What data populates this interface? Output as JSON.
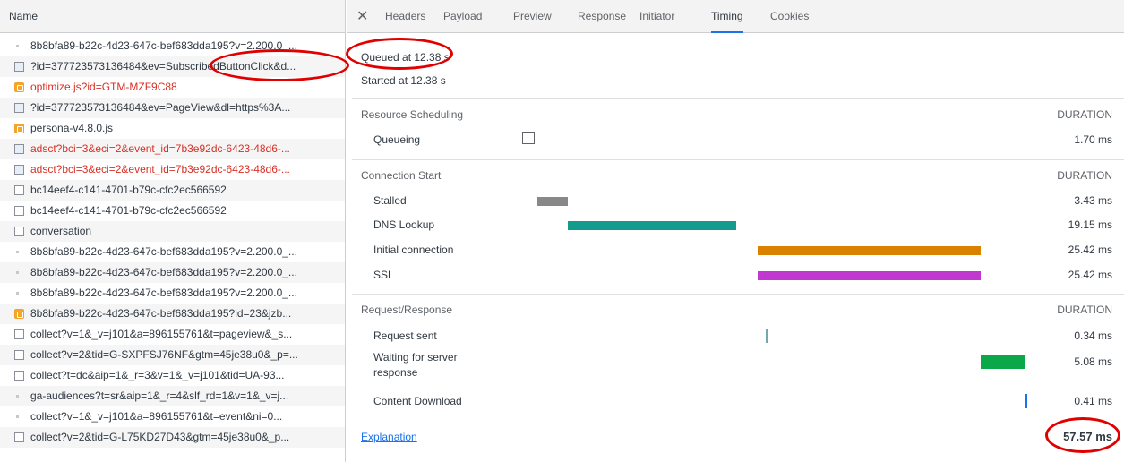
{
  "request_list": {
    "header": "Name",
    "items": [
      {
        "name": "8b8bfa89-b22c-4d23-647c-bef683dda195?v=2.200.0_...",
        "icon": "dot",
        "red": false
      },
      {
        "name": "?id=377723573136484&ev=SubscribedButtonClick&d...",
        "icon": "xhr",
        "red": false
      },
      {
        "name": "optimize.js?id=GTM-MZF9C88",
        "icon": "js",
        "red": true
      },
      {
        "name": "?id=377723573136484&ev=PageView&dl=https%3A...",
        "icon": "xhr",
        "red": false
      },
      {
        "name": "persona-v4.8.0.js",
        "icon": "js",
        "red": false
      },
      {
        "name": "adsct?bci=3&eci=2&event_id=7b3e92dc-6423-48d6-...",
        "icon": "xhr",
        "red": true
      },
      {
        "name": "adsct?bci=3&eci=2&event_id=7b3e92dc-6423-48d6-...",
        "icon": "xhr",
        "red": true
      },
      {
        "name": "bc14eef4-c141-4701-b79c-cfc2ec566592",
        "icon": "doc",
        "red": false
      },
      {
        "name": "bc14eef4-c141-4701-b79c-cfc2ec566592",
        "icon": "doc",
        "red": false
      },
      {
        "name": "conversation",
        "icon": "doc",
        "red": false
      },
      {
        "name": "8b8bfa89-b22c-4d23-647c-bef683dda195?v=2.200.0_...",
        "icon": "dot",
        "red": false
      },
      {
        "name": "8b8bfa89-b22c-4d23-647c-bef683dda195?v=2.200.0_...",
        "icon": "dot",
        "red": false
      },
      {
        "name": "8b8bfa89-b22c-4d23-647c-bef683dda195?v=2.200.0_...",
        "icon": "dot",
        "red": false
      },
      {
        "name": "8b8bfa89-b22c-4d23-647c-bef683dda195?id=23&jzb...",
        "icon": "js",
        "red": false
      },
      {
        "name": "collect?v=1&_v=j101&a=896155761&t=pageview&_s...",
        "icon": "doc",
        "red": false
      },
      {
        "name": "collect?v=2&tid=G-SXPFSJ76NF&gtm=45je38u0&_p=...",
        "icon": "doc",
        "red": false
      },
      {
        "name": "collect?t=dc&aip=1&_r=3&v=1&_v=j101&tid=UA-93...",
        "icon": "doc",
        "red": false
      },
      {
        "name": "ga-audiences?t=sr&aip=1&_r=4&slf_rd=1&v=1&_v=j...",
        "icon": "dot",
        "red": false
      },
      {
        "name": "collect?v=1&_v=j101&a=896155761&t=event&ni=0...",
        "icon": "dot",
        "red": false
      },
      {
        "name": "collect?v=2&tid=G-L75KD27D43&gtm=45je38u0&_p...",
        "icon": "doc",
        "red": false
      }
    ]
  },
  "tabs": {
    "close": "✕",
    "items": [
      "Headers",
      "Payload",
      "Preview",
      "Response",
      "Initiator",
      "Timing",
      "Cookies"
    ],
    "active": "Timing"
  },
  "timing": {
    "queued_at": "Queued at 12.38 s",
    "started_at": "Started at 12.38 s",
    "duration_header": "DURATION",
    "sections": [
      {
        "title": "Resource Scheduling",
        "rows": [
          {
            "label": "Queueing",
            "duration": "1.70 ms",
            "color": ""
          }
        ]
      },
      {
        "title": "Connection Start",
        "rows": [
          {
            "label": "Stalled",
            "duration": "3.43 ms",
            "color": "#888888"
          },
          {
            "label": "DNS Lookup",
            "duration": "19.15 ms",
            "color": "#139c8e"
          },
          {
            "label": "Initial connection",
            "duration": "25.42 ms",
            "color": "#d98200"
          },
          {
            "label": "SSL",
            "duration": "25.42 ms",
            "color": "#c038d0"
          }
        ]
      },
      {
        "title": "Request/Response",
        "rows": [
          {
            "label": "Request sent",
            "duration": "0.34 ms",
            "color": "#76a8a8"
          },
          {
            "label": "Waiting for server response",
            "duration": "5.08 ms",
            "color": "#0ba84a"
          },
          {
            "label": "Content Download",
            "duration": "0.41 ms",
            "color": "#1a73e8"
          }
        ]
      }
    ],
    "explanation": "Explanation",
    "total": "57.57 ms"
  },
  "colors": {
    "accent": "#1a73e8",
    "annotation": "#e00000"
  }
}
